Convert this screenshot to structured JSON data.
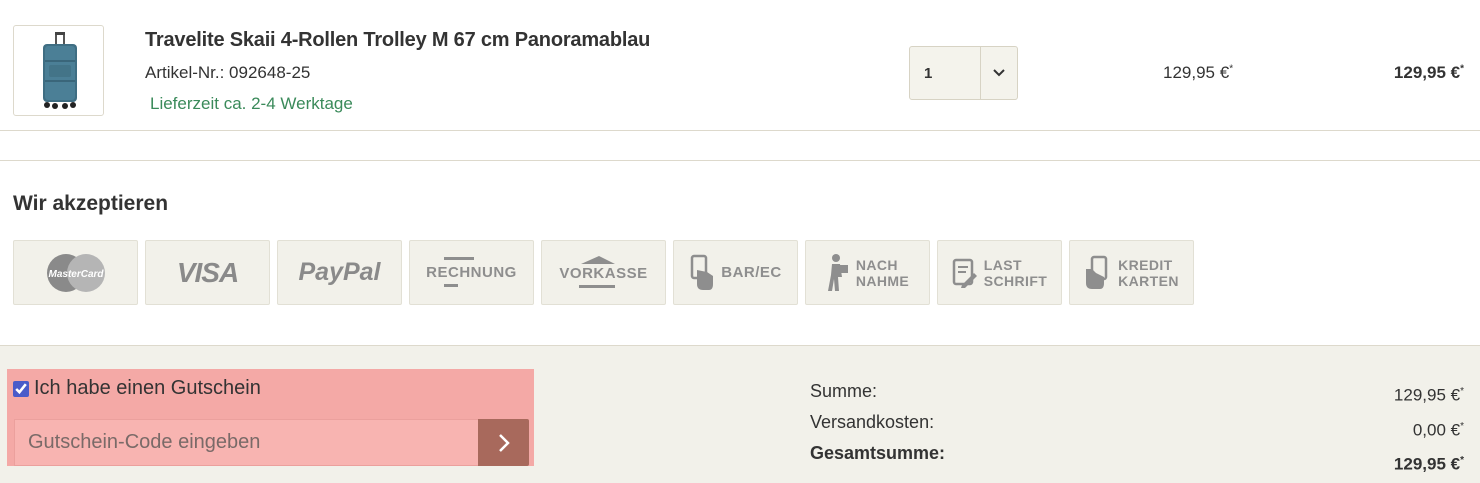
{
  "cart_item": {
    "title": "Travelite Skaii 4-Rollen Trolley M 67 cm Panoramablau",
    "article_number": "Artikel-Nr.: 092648-25",
    "delivery": "Lieferzeit ca. 2-4 Werktage",
    "quantity": "1",
    "unit_price": "129,95 €",
    "total_price": "129,95 €",
    "price_marker": "*"
  },
  "payment": {
    "heading": "Wir akzeptieren",
    "methods": {
      "mastercard": "MasterCard",
      "visa": "VISA",
      "paypal": "PayPal",
      "rechnung": "RECHNUNG",
      "vorkasse": "VORKASSE",
      "barec": "BAR/EC",
      "nachnahme_1": "NACH",
      "nachnahme_2": "NAHME",
      "lastschrift_1": "LAST",
      "lastschrift_2": "SCHRIFT",
      "kredit_1": "KREDIT",
      "kredit_2": "KARTEN"
    }
  },
  "voucher": {
    "checkbox_label": "Ich habe einen Gutschein",
    "placeholder": "Gutschein-Code eingeben"
  },
  "summary": {
    "summe_label": "Summe:",
    "summe_value": "129,95 €",
    "versand_label": "Versandkosten:",
    "versand_value": "0,00 €",
    "gesamt_label": "Gesamtsumme:",
    "gesamt_value": "129,95 €"
  },
  "colors": {
    "accent_green": "#3a8a5a",
    "voucher_highlight": "#f4a9a6",
    "voucher_button": "#a8695c",
    "panel_bg": "#f2f1ea"
  },
  "icons": [
    "suitcase-product-image",
    "chevron-down-icon",
    "chevron-right-icon",
    "mastercard-logo",
    "visa-logo",
    "paypal-logo",
    "invoice-icon",
    "prepayment-icon",
    "card-hand-icon",
    "courier-icon",
    "direct-debit-icon",
    "credit-cards-icon"
  ]
}
